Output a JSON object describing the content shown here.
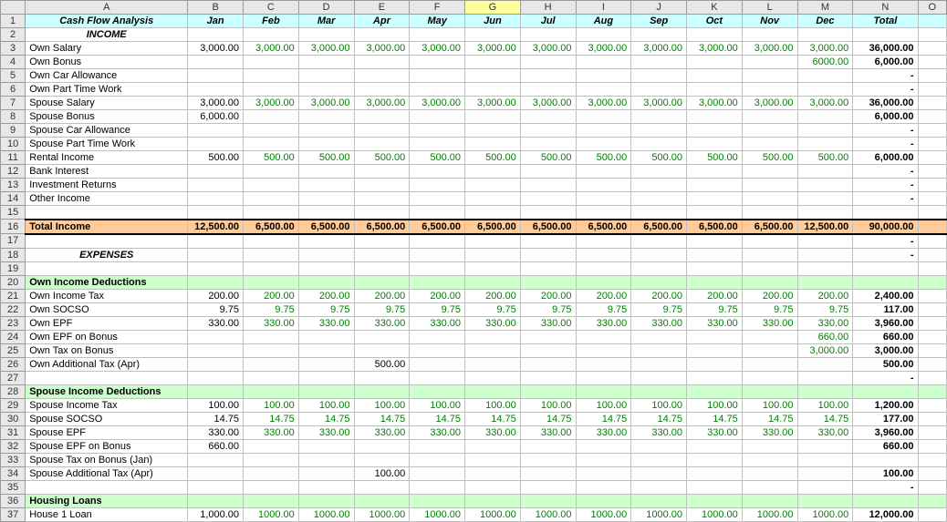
{
  "chart_data": {
    "type": "table",
    "title": "Cash Flow Analysis",
    "columns": [
      "Jan",
      "Feb",
      "Mar",
      "Apr",
      "May",
      "Jun",
      "Jul",
      "Aug",
      "Sep",
      "Oct",
      "Nov",
      "Dec",
      "Total"
    ],
    "rows": [
      {
        "label": "Own Salary",
        "values": [
          "3,000.00",
          "3,000.00",
          "3,000.00",
          "3,000.00",
          "3,000.00",
          "3,000.00",
          "3,000.00",
          "3,000.00",
          "3,000.00",
          "3,000.00",
          "3,000.00",
          "3,000.00",
          "36,000.00"
        ]
      },
      {
        "label": "Own Bonus",
        "values": [
          "",
          "",
          "",
          "",
          "",
          "",
          "",
          "",
          "",
          "",
          "",
          "6000.00",
          "6,000.00"
        ]
      },
      {
        "label": "Spouse Salary",
        "values": [
          "3,000.00",
          "3,000.00",
          "3,000.00",
          "3,000.00",
          "3,000.00",
          "3,000.00",
          "3,000.00",
          "3,000.00",
          "3,000.00",
          "3,000.00",
          "3,000.00",
          "3,000.00",
          "36,000.00"
        ]
      },
      {
        "label": "Spouse Bonus",
        "values": [
          "6,000.00",
          "",
          "",
          "",
          "",
          "",
          "",
          "",
          "",
          "",
          "",
          "",
          "6,000.00"
        ]
      },
      {
        "label": "Rental Income",
        "values": [
          "500.00",
          "500.00",
          "500.00",
          "500.00",
          "500.00",
          "500.00",
          "500.00",
          "500.00",
          "500.00",
          "500.00",
          "500.00",
          "500.00",
          "6,000.00"
        ]
      },
      {
        "label": "Total Income",
        "values": [
          "12,500.00",
          "6,500.00",
          "6,500.00",
          "6,500.00",
          "6,500.00",
          "6,500.00",
          "6,500.00",
          "6,500.00",
          "6,500.00",
          "6,500.00",
          "6,500.00",
          "12,500.00",
          "90,000.00"
        ]
      },
      {
        "label": "Own Income Tax",
        "values": [
          "200.00",
          "200.00",
          "200.00",
          "200.00",
          "200.00",
          "200.00",
          "200.00",
          "200.00",
          "200.00",
          "200.00",
          "200.00",
          "200.00",
          "2,400.00"
        ]
      },
      {
        "label": "Own SOCSO",
        "values": [
          "9.75",
          "9.75",
          "9.75",
          "9.75",
          "9.75",
          "9.75",
          "9.75",
          "9.75",
          "9.75",
          "9.75",
          "9.75",
          "9.75",
          "117.00"
        ]
      },
      {
        "label": "Own EPF",
        "values": [
          "330.00",
          "330.00",
          "330.00",
          "330.00",
          "330.00",
          "330.00",
          "330.00",
          "330.00",
          "330.00",
          "330.00",
          "330.00",
          "330.00",
          "3,960.00"
        ]
      },
      {
        "label": "Own EPF on Bonus",
        "values": [
          "",
          "",
          "",
          "",
          "",
          "",
          "",
          "",
          "",
          "",
          "",
          "660.00",
          "660.00"
        ]
      },
      {
        "label": "Own Tax on Bonus",
        "values": [
          "",
          "",
          "",
          "",
          "",
          "",
          "",
          "",
          "",
          "",
          "",
          "3,000.00",
          "3,000.00"
        ]
      },
      {
        "label": "Own Additional Tax (Apr)",
        "values": [
          "",
          "",
          "",
          "500.00",
          "",
          "",
          "",
          "",
          "",
          "",
          "",
          "",
          "500.00"
        ]
      },
      {
        "label": "Spouse Income Tax",
        "values": [
          "100.00",
          "100.00",
          "100.00",
          "100.00",
          "100.00",
          "100.00",
          "100.00",
          "100.00",
          "100.00",
          "100.00",
          "100.00",
          "100.00",
          "1,200.00"
        ]
      },
      {
        "label": "Spouse SOCSO",
        "values": [
          "14.75",
          "14.75",
          "14.75",
          "14.75",
          "14.75",
          "14.75",
          "14.75",
          "14.75",
          "14.75",
          "14.75",
          "14.75",
          "14.75",
          "177.00"
        ]
      },
      {
        "label": "Spouse EPF",
        "values": [
          "330.00",
          "330.00",
          "330.00",
          "330.00",
          "330.00",
          "330.00",
          "330.00",
          "330.00",
          "330.00",
          "330.00",
          "330.00",
          "330.00",
          "3,960.00"
        ]
      },
      {
        "label": "Spouse EPF on Bonus",
        "values": [
          "660.00",
          "",
          "",
          "",
          "",
          "",
          "",
          "",
          "",
          "",
          "",
          "",
          "660.00"
        ]
      },
      {
        "label": "Spouse Additional Tax (Apr)",
        "values": [
          "",
          "",
          "",
          "100.00",
          "",
          "",
          "",
          "",
          "",
          "",
          "",
          "",
          "100.00"
        ]
      },
      {
        "label": "House 1 Loan",
        "values": [
          "1,000.00",
          "1000.00",
          "1000.00",
          "1000.00",
          "1000.00",
          "1000.00",
          "1000.00",
          "1000.00",
          "1000.00",
          "1000.00",
          "1000.00",
          "1000.00",
          "12,000.00"
        ]
      }
    ]
  },
  "colHeaders": [
    "",
    "A",
    "B",
    "C",
    "D",
    "E",
    "F",
    "G",
    "H",
    "I",
    "J",
    "K",
    "L",
    "M",
    "N",
    "O"
  ],
  "title": "Cash Flow Analysis",
  "months": [
    "Jan",
    "Feb",
    "Mar",
    "Apr",
    "May",
    "Jun",
    "Jul",
    "Aug",
    "Sep",
    "Oct",
    "Nov",
    "Dec"
  ],
  "totalLabel": "Total",
  "sections": {
    "income": "INCOME",
    "expenses": "EXPENSES",
    "ownDeductions": "Own Income Deductions",
    "spouseDeductions": "Spouse Income Deductions",
    "housingLoans": "Housing Loans",
    "totalIncome": "Total Income"
  },
  "rows": {
    "r3": {
      "label": "Own Salary",
      "v": [
        "3,000.00",
        "3,000.00",
        "3,000.00",
        "3,000.00",
        "3,000.00",
        "3,000.00",
        "3,000.00",
        "3,000.00",
        "3,000.00",
        "3,000.00",
        "3,000.00",
        "3,000.00"
      ],
      "t": "36,000.00"
    },
    "r4": {
      "label": "Own Bonus",
      "v": [
        "",
        "",
        "",
        "",
        "",
        "",
        "",
        "",
        "",
        "",
        "",
        "6000.00"
      ],
      "t": "6,000.00"
    },
    "r5": {
      "label": "Own Car Allowance",
      "v": [
        "",
        "",
        "",
        "",
        "",
        "",
        "",
        "",
        "",
        "",
        "",
        ""
      ],
      "t": "-"
    },
    "r6": {
      "label": "Own Part Time Work",
      "v": [
        "",
        "",
        "",
        "",
        "",
        "",
        "",
        "",
        "",
        "",
        "",
        ""
      ],
      "t": "-"
    },
    "r7": {
      "label": "Spouse Salary",
      "v": [
        "3,000.00",
        "3,000.00",
        "3,000.00",
        "3,000.00",
        "3,000.00",
        "3,000.00",
        "3,000.00",
        "3,000.00",
        "3,000.00",
        "3,000.00",
        "3,000.00",
        "3,000.00"
      ],
      "t": "36,000.00"
    },
    "r8": {
      "label": "Spouse Bonus",
      "v": [
        "6,000.00",
        "",
        "",
        "",
        "",
        "",
        "",
        "",
        "",
        "",
        "",
        ""
      ],
      "t": "6,000.00"
    },
    "r9": {
      "label": "Spouse Car Allowance",
      "v": [
        "",
        "",
        "",
        "",
        "",
        "",
        "",
        "",
        "",
        "",
        "",
        ""
      ],
      "t": "-"
    },
    "r10": {
      "label": "Spouse Part Time Work",
      "v": [
        "",
        "",
        "",
        "",
        "",
        "",
        "",
        "",
        "",
        "",
        "",
        ""
      ],
      "t": "-"
    },
    "r11": {
      "label": "Rental Income",
      "v": [
        "500.00",
        "500.00",
        "500.00",
        "500.00",
        "500.00",
        "500.00",
        "500.00",
        "500.00",
        "500.00",
        "500.00",
        "500.00",
        "500.00"
      ],
      "t": "6,000.00"
    },
    "r12": {
      "label": "Bank Interest",
      "v": [
        "",
        "",
        "",
        "",
        "",
        "",
        "",
        "",
        "",
        "",
        "",
        ""
      ],
      "t": "-"
    },
    "r13": {
      "label": "Investment Returns",
      "v": [
        "",
        "",
        "",
        "",
        "",
        "",
        "",
        "",
        "",
        "",
        "",
        ""
      ],
      "t": "-"
    },
    "r14": {
      "label": "Other Income",
      "v": [
        "",
        "",
        "",
        "",
        "",
        "",
        "",
        "",
        "",
        "",
        "",
        ""
      ],
      "t": "-"
    },
    "r16": {
      "label": "Total Income",
      "v": [
        "12,500.00",
        "6,500.00",
        "6,500.00",
        "6,500.00",
        "6,500.00",
        "6,500.00",
        "6,500.00",
        "6,500.00",
        "6,500.00",
        "6,500.00",
        "6,500.00",
        "12,500.00"
      ],
      "t": "90,000.00"
    },
    "r17": {
      "t": "-"
    },
    "r18": {
      "t": "-"
    },
    "r21": {
      "label": "Own Income Tax",
      "v": [
        "200.00",
        "200.00",
        "200.00",
        "200.00",
        "200.00",
        "200.00",
        "200.00",
        "200.00",
        "200.00",
        "200.00",
        "200.00",
        "200.00"
      ],
      "t": "2,400.00"
    },
    "r22": {
      "label": "Own SOCSO",
      "v": [
        "9.75",
        "9.75",
        "9.75",
        "9.75",
        "9.75",
        "9.75",
        "9.75",
        "9.75",
        "9.75",
        "9.75",
        "9.75",
        "9.75"
      ],
      "t": "117.00"
    },
    "r23": {
      "label": "Own EPF",
      "v": [
        "330.00",
        "330.00",
        "330.00",
        "330.00",
        "330.00",
        "330.00",
        "330.00",
        "330.00",
        "330.00",
        "330.00",
        "330.00",
        "330.00"
      ],
      "t": "3,960.00"
    },
    "r24": {
      "label": "Own EPF on Bonus",
      "v": [
        "",
        "",
        "",
        "",
        "",
        "",
        "",
        "",
        "",
        "",
        "",
        "660.00"
      ],
      "t": "660.00"
    },
    "r25": {
      "label": "Own Tax on Bonus",
      "v": [
        "",
        "",
        "",
        "",
        "",
        "",
        "",
        "",
        "",
        "",
        "",
        "3,000.00"
      ],
      "t": "3,000.00"
    },
    "r26": {
      "label": "Own Additional Tax (Apr)",
      "v": [
        "",
        "",
        "",
        "500.00",
        "",
        "",
        "",
        "",
        "",
        "",
        "",
        ""
      ],
      "t": "500.00"
    },
    "r27": {
      "t": "-"
    },
    "r29": {
      "label": "Spouse Income Tax",
      "v": [
        "100.00",
        "100.00",
        "100.00",
        "100.00",
        "100.00",
        "100.00",
        "100.00",
        "100.00",
        "100.00",
        "100.00",
        "100.00",
        "100.00"
      ],
      "t": "1,200.00"
    },
    "r30": {
      "label": "Spouse SOCSO",
      "v": [
        "14.75",
        "14.75",
        "14.75",
        "14.75",
        "14.75",
        "14.75",
        "14.75",
        "14.75",
        "14.75",
        "14.75",
        "14.75",
        "14.75"
      ],
      "t": "177.00"
    },
    "r31": {
      "label": "Spouse EPF",
      "v": [
        "330.00",
        "330.00",
        "330.00",
        "330.00",
        "330.00",
        "330.00",
        "330.00",
        "330.00",
        "330.00",
        "330.00",
        "330.00",
        "330.00"
      ],
      "t": "3,960.00"
    },
    "r32": {
      "label": "Spouse EPF on Bonus",
      "v": [
        "660.00",
        "",
        "",
        "",
        "",
        "",
        "",
        "",
        "",
        "",
        "",
        ""
      ],
      "t": "660.00"
    },
    "r33": {
      "label": "Spouse Tax on Bonus (Jan)",
      "v": [
        "",
        "",
        "",
        "",
        "",
        "",
        "",
        "",
        "",
        "",
        "",
        ""
      ],
      "t": ""
    },
    "r34": {
      "label": "Spouse Additional Tax (Apr)",
      "v": [
        "",
        "",
        "",
        "100.00",
        "",
        "",
        "",
        "",
        "",
        "",
        "",
        ""
      ],
      "t": "100.00"
    },
    "r35": {
      "t": "-"
    },
    "r37": {
      "label": "House 1 Loan",
      "v": [
        "1,000.00",
        "1000.00",
        "1000.00",
        "1000.00",
        "1000.00",
        "1000.00",
        "1000.00",
        "1000.00",
        "1000.00",
        "1000.00",
        "1000.00",
        "1000.00"
      ],
      "t": "12,000.00"
    }
  }
}
